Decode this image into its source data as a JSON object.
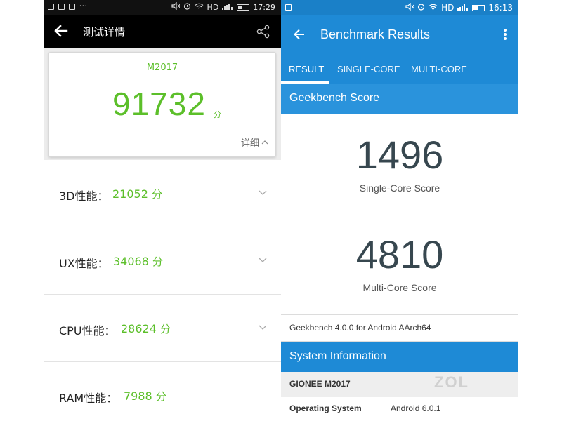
{
  "left": {
    "status": {
      "time": "17:29",
      "network": "HD",
      "dots": "···"
    },
    "header": {
      "title": "测试详情",
      "back_icon": "arrow-left-icon",
      "share_icon": "share-icon"
    },
    "score_card": {
      "model": "M2017",
      "score": "91732",
      "unit": "分",
      "detail_label": "详细"
    },
    "perf_rows": [
      {
        "label": "3D性能：",
        "value": "21052",
        "unit": "分"
      },
      {
        "label": "UX性能：",
        "value": "34068",
        "unit": "分"
      },
      {
        "label": "CPU性能：",
        "value": "28624",
        "unit": "分"
      },
      {
        "label": "RAM性能：",
        "value": "7988",
        "unit": "分"
      }
    ],
    "accent_color": "#5cbf2a"
  },
  "right": {
    "status": {
      "time": "16:13",
      "network": "HD"
    },
    "appbar": {
      "title": "Benchmark Results"
    },
    "tabs": [
      "RESULT",
      "SINGLE-CORE",
      "MULTI-CORE"
    ],
    "selected_tab": "RESULT",
    "geekbench_header": "Geekbench Score",
    "single_score": "1496",
    "single_caption": "Single-Core Score",
    "multi_score": "4810",
    "multi_caption": "Multi-Core Score",
    "version": "Geekbench 4.0.0 for Android AArch64",
    "sysinfo_header": "System Information",
    "device": "GIONEE M2017",
    "info_rows": [
      {
        "key": "Operating System",
        "value": "Android 6.0.1"
      }
    ],
    "accent_color": "#1e8ad6"
  }
}
